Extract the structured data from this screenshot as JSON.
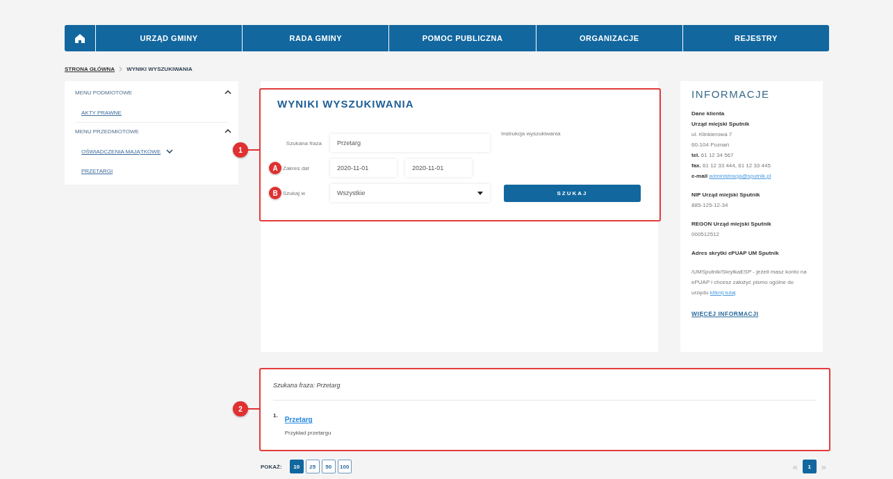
{
  "nav": {
    "items": [
      {
        "label": "URZĄD GMINY"
      },
      {
        "label": "RADA GMINY"
      },
      {
        "label": "POMOC PUBLICZNA"
      },
      {
        "label": "ORGANIZACJE"
      },
      {
        "label": "REJESTRY"
      }
    ]
  },
  "breadcrumb": [
    {
      "label": "STRONA GŁÓWNA",
      "kind": "link"
    },
    {
      "label": "WYNIKI WYSZUKIWANIA",
      "kind": "current"
    }
  ],
  "sidebar": {
    "sections": [
      {
        "title": "MENU PODMIOTOWE",
        "expanded": true,
        "items": [
          {
            "label": "AKTY PRAWNE",
            "kind": "link"
          }
        ]
      },
      {
        "title": "MENU PRZEDMIOTOWE",
        "expanded": true,
        "items": [
          {
            "label": "OŚWIADCZENIA MAJĄTKOWE",
            "kind": "submenu"
          },
          {
            "label": "PRZETARGI",
            "kind": "link"
          }
        ]
      }
    ]
  },
  "search": {
    "title": "WYNIKI WYSZUKIWANIA",
    "marker": "1",
    "phrase": {
      "label": "Szukana fraza",
      "value": "Przetarg"
    },
    "help": "Instrukcja wyszukiwania",
    "dates": {
      "marker": "A",
      "label": "Zakres dat",
      "from": "2020-11-01",
      "to": "2020-11-01"
    },
    "scope": {
      "marker": "B",
      "label": "Szukaj w",
      "value": "Wszystkie"
    },
    "button": "SZUKAJ"
  },
  "info": {
    "title": "INFORMACJE",
    "groups": [
      [
        {
          "kind": "heading",
          "text": "Dane klienta"
        },
        {
          "kind": "heading",
          "text": "Urząd miejski Sputnik"
        },
        {
          "kind": "text",
          "text": "ul. Klinkierowa 7"
        },
        {
          "kind": "text",
          "text": "60-104 Poznań"
        },
        {
          "kind": "text",
          "text": "**tel.** 61 12 34 567"
        },
        {
          "kind": "text",
          "text": "**fax.** 61 12 33 444, 61 12 33 445"
        },
        {
          "kind": "text",
          "text": "**e-mail**",
          "link": "administracja@sputnik.pl"
        }
      ],
      [
        {
          "kind": "heading",
          "text": "NIP Urząd miejski Sputnik"
        },
        {
          "kind": "text",
          "text": "885-125-12-34"
        }
      ],
      [
        {
          "kind": "heading",
          "text": "REGON Urząd miejski Sputnik"
        },
        {
          "kind": "text",
          "text": "000512512"
        }
      ],
      [
        {
          "kind": "heading",
          "text": "Adres skrytki ePUAP UM Sputnik"
        }
      ],
      [
        {
          "kind": "text",
          "text": "/UMSputnik/SkrytkaESP - jeżeli masz konto na ePUAP i chcesz założyć pismo ogólne do urzędu",
          "link": "kliknij tutaj"
        }
      ]
    ],
    "more": "WIĘCEJ INFORMACJI"
  },
  "results": {
    "marker": "2",
    "query": "Szukana fraza: Przetarg",
    "items": [
      {
        "number": "1.",
        "title": "Przetarg",
        "description": "Przykład przetargu"
      }
    ]
  },
  "pagination": {
    "label": "POKAŻ:",
    "sizes": [
      {
        "label": "10",
        "selected": true
      },
      {
        "label": "25",
        "selected": false
      },
      {
        "label": "50",
        "selected": false
      },
      {
        "label": "100",
        "selected": false
      }
    ],
    "prev": {
      "text": "«",
      "disabled": true
    },
    "pages": [
      {
        "label": "1",
        "selected": true
      }
    ],
    "next": {
      "text": "»",
      "disabled": true
    }
  }
}
